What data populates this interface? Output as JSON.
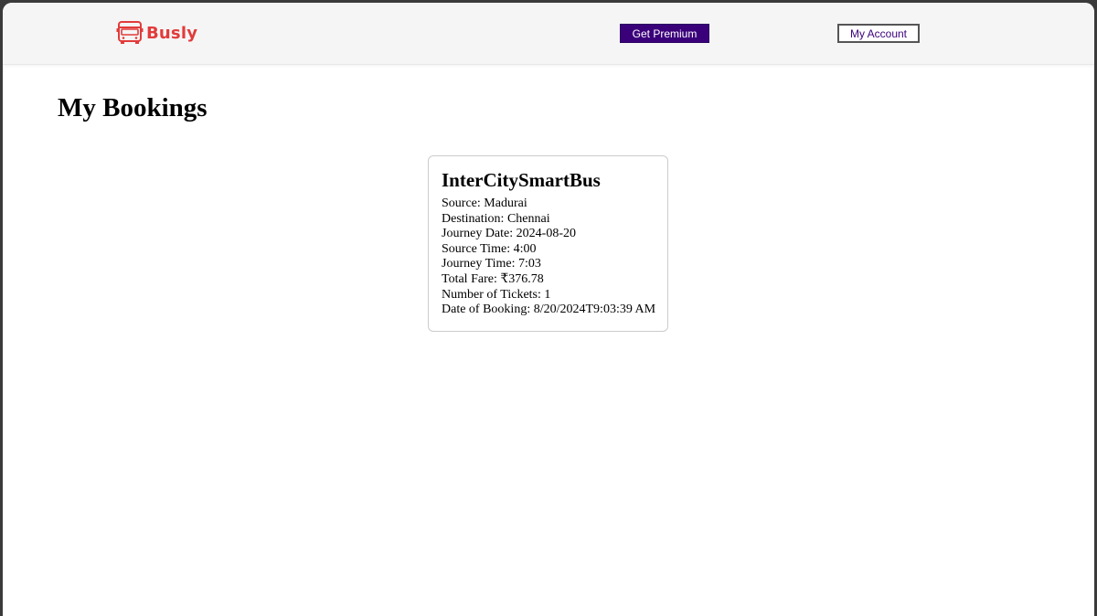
{
  "header": {
    "brand": "Busly",
    "premium_label": "Get Premium",
    "account_label": "My Account"
  },
  "colors": {
    "brand": "#e23b3b",
    "premium_bg": "#3a007a",
    "account_text": "#3a007a"
  },
  "icons": {
    "logo": "bus-icon"
  },
  "page": {
    "title": "My Bookings"
  },
  "bookings": [
    {
      "bus_name": "InterCitySmartBus",
      "fields": [
        {
          "label": "Source",
          "value": "Madurai"
        },
        {
          "label": "Destination",
          "value": "Chennai"
        },
        {
          "label": "Journey Date",
          "value": "2024-08-20"
        },
        {
          "label": "Source Time",
          "value": "4:00"
        },
        {
          "label": "Journey Time",
          "value": "7:03"
        },
        {
          "label": "Total Fare",
          "value": "₹376.78"
        },
        {
          "label": "Number of Tickets",
          "value": "1"
        },
        {
          "label": "Date of Booking",
          "value": "8/20/2024T9:03:39 AM"
        }
      ]
    }
  ]
}
